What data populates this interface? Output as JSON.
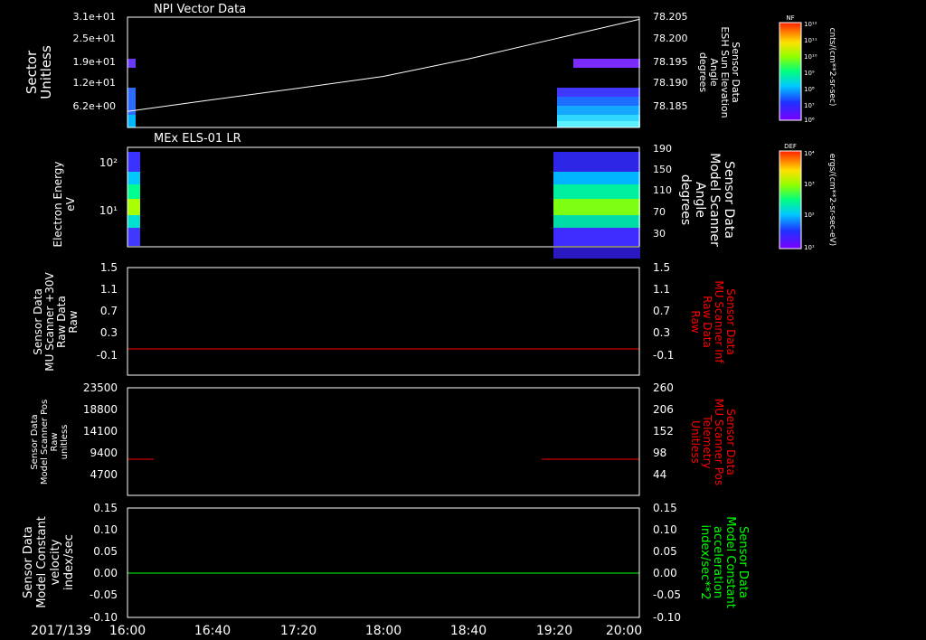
{
  "time_axis": {
    "date_label": "2017/139",
    "ticks": [
      "16:00",
      "16:40",
      "17:20",
      "18:00",
      "18:40",
      "19:20",
      "20:00"
    ]
  },
  "colors": {
    "background": "#000000",
    "axes": "#ffffff",
    "red_trace": "#ff0000",
    "green_trace": "#00ff00"
  },
  "chart_data": [
    {
      "type": "heatmap",
      "title": "NPI Vector Data",
      "ylabel_left": [
        "Sector",
        "Unitless"
      ],
      "yticks_left": [
        "3.1e+01",
        "2.5e+01",
        "1.9e+01",
        "1.2e+01",
        "6.2e+00"
      ],
      "ylabel_right": [
        "Sensor Data",
        "ESH Sun Elevation",
        "Angle",
        "degrees"
      ],
      "yticks_right": [
        "78.205",
        "78.200",
        "78.195",
        "78.190",
        "78.185"
      ],
      "overlay_line": {
        "name": "ESH Sun Elevation",
        "x": [
          "16:00",
          "16:40",
          "17:20",
          "18:00",
          "18:40",
          "19:20",
          "20:00"
        ],
        "y": [
          78.1835,
          78.1862,
          78.1888,
          78.1915,
          78.1955,
          78.2,
          78.2045
        ]
      },
      "colorbar": {
        "label": "NF",
        "units": "cnts/(cm**2-sr-sec)",
        "ticks": [
          "10¹²",
          "10¹¹",
          "10¹⁰",
          "10⁹",
          "10⁸",
          "10⁷",
          "10⁶"
        ]
      },
      "data_segments": [
        "16:00-16:03",
        "19:19-20:00"
      ]
    },
    {
      "type": "heatmap",
      "title": "MEx ELS-01 LR",
      "ylabel_left": [
        "Electron Energy",
        "eV"
      ],
      "yticks_left": [
        "10²",
        "10¹"
      ],
      "ylabel_right": [
        "Sensor Data",
        "Model Scanner",
        "Angle",
        "degrees"
      ],
      "yticks_right": [
        "190",
        "150",
        "110",
        "70",
        "30"
      ],
      "colorbar": {
        "label": "DEF",
        "units": "ergs/(cm**2-sr-sec-eV)",
        "ticks": [
          "10⁴",
          "10³",
          "10²",
          "10¹"
        ]
      },
      "data_segments": [
        "16:00-16:03",
        "19:19-20:00"
      ]
    },
    {
      "type": "line",
      "ylabel_left": [
        "Sensor Data",
        "MU Scanner +30V",
        "Raw Data",
        "Raw"
      ],
      "yticks_left": [
        "1.5",
        "1.1",
        "0.7",
        "0.3",
        "-0.1"
      ],
      "ylabel_right": [
        "Sensor Data",
        "MU Scanner Inf",
        "Raw Data",
        "Raw"
      ],
      "yticks_right": [
        "1.5",
        "1.1",
        "0.7",
        "0.3",
        "-0.1"
      ],
      "ylim": [
        -0.3,
        1.5
      ],
      "series": [
        {
          "x": [
            "16:00",
            "20:00"
          ],
          "y": [
            0.0,
            0.0
          ]
        }
      ]
    },
    {
      "type": "line",
      "ylabel_left": [
        "Sensor Data",
        "Model Scanner Pos",
        "Raw",
        "unitless"
      ],
      "yticks_left": [
        "23500",
        "18800",
        "14100",
        "9400",
        "4700"
      ],
      "ylabel_right": [
        "Sensor Data",
        "MU Scanner Pos",
        "Telemetry",
        "Unitless"
      ],
      "yticks_right": [
        "260",
        "206",
        "152",
        "98",
        "44"
      ],
      "ylim": [
        0,
        23500
      ],
      "series": [
        {
          "x": [
            "16:00",
            "16:07"
          ],
          "y": [
            8100,
            8100
          ]
        },
        {
          "x": [
            "19:14",
            "20:00"
          ],
          "y": [
            8100,
            8100
          ]
        }
      ]
    },
    {
      "type": "line",
      "ylabel_left": [
        "Sensor Data",
        "Model Constant",
        "velocity",
        "index/sec"
      ],
      "yticks_left": [
        "0.15",
        "0.10",
        "0.05",
        "0.00",
        "-0.05",
        "-0.10"
      ],
      "ylabel_right": [
        "Sensor Data",
        "Model Constant",
        "acceleration",
        "index/sec**2"
      ],
      "yticks_right": [
        "0.15",
        "0.10",
        "0.05",
        "0.00",
        "-0.05",
        "-0.10"
      ],
      "ylim": [
        -0.1,
        0.15
      ],
      "series": [
        {
          "x": [
            "16:00",
            "20:00"
          ],
          "y": [
            0.0,
            0.0
          ]
        }
      ]
    }
  ]
}
